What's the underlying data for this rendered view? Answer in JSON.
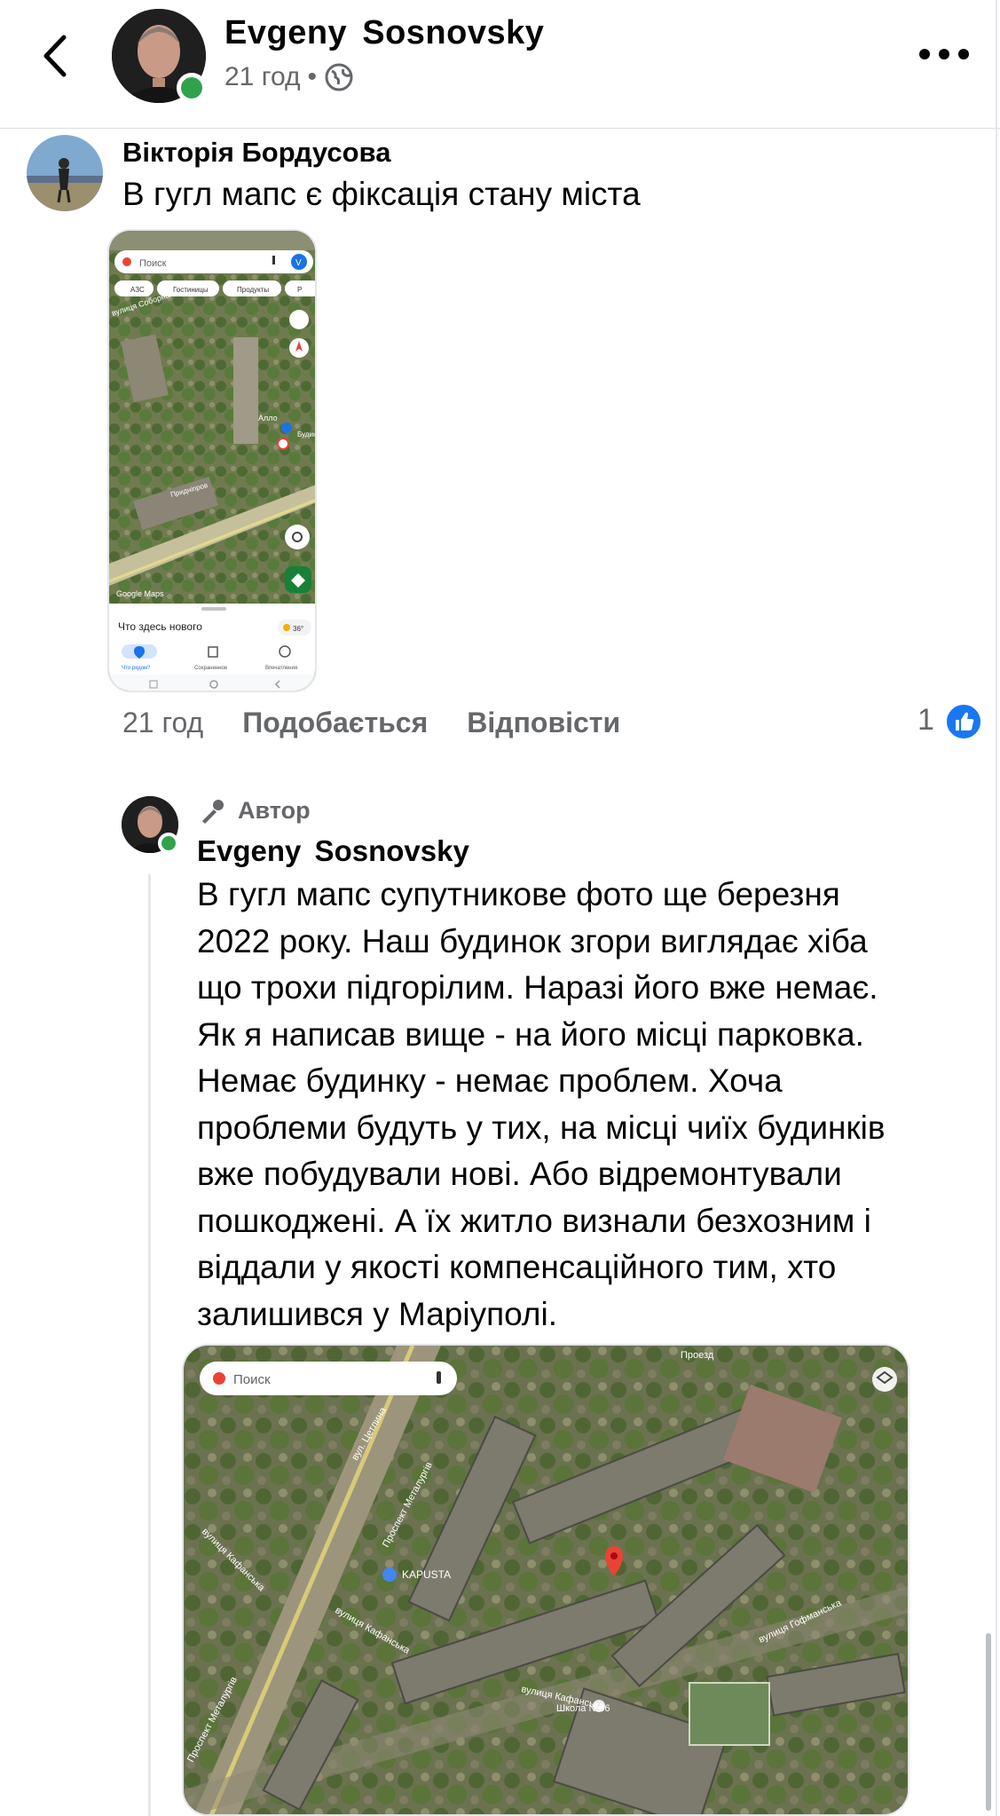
{
  "header": {
    "back_label": "",
    "name": "Evgeny  Sosnovsky",
    "time": "21 год",
    "separator": "•"
  },
  "comment": {
    "author": "Вікторія Бордусова",
    "text": "В гугл мапс є фіксація стану міста",
    "time": "21 год",
    "like_label": "Подобається",
    "reply_label": "Відповісти",
    "like_count": "1",
    "screenshot": {
      "search_placeholder": "Поиск",
      "avatar_letter": "V",
      "chips": [
        "АЗС",
        "Гостиницы",
        "Продукты",
        "Р"
      ],
      "streets": [
        "вулиця Соборна",
        "Придніпров"
      ],
      "places": [
        "Алло",
        "Будин"
      ],
      "watermark": "Google Maps",
      "sheet_title": "Что здесь нового",
      "temp": "36°",
      "nav": [
        "Что рядом?",
        "Сохраненное",
        "Впечатления"
      ]
    }
  },
  "reply": {
    "badge": "Автор",
    "author": "Evgeny  Sosnovsky",
    "text_lines": [
      "В гугл мапс супутникове фото ще березня",
      "2022 року. Наш будинок згори виглядає хіба",
      "що трохи підгорілим. Наразі його вже немає.",
      "Як я написав вище - на його місці парковка.",
      "Немає будинку - немає проблем. Хоча",
      "проблеми будуть у тих, на місці чиїх будинків",
      "вже побудували нові. Або відремонтували",
      "пошкоджені. А їх житло визнали безхозним і",
      "віддали у якості компенсаційного тим, хто",
      "залишився у Маріуполі."
    ],
    "map": {
      "search_placeholder": "Поиск",
      "streets": [
        "вул. Цетлина",
        "Проспект Металургів",
        "вулиця Кафанська",
        "вулиця Кафанська",
        "вулиця Кафанська",
        "вулиця Гофманська",
        "Проспект Металургів",
        "Проезд"
      ],
      "places": [
        "KAPUSTA",
        "Школа №66"
      ]
    }
  },
  "colors": {
    "accent": "#1877f2",
    "online": "#31a24c",
    "secondary_text": "#65676b",
    "divider": "#e4e6eb"
  }
}
